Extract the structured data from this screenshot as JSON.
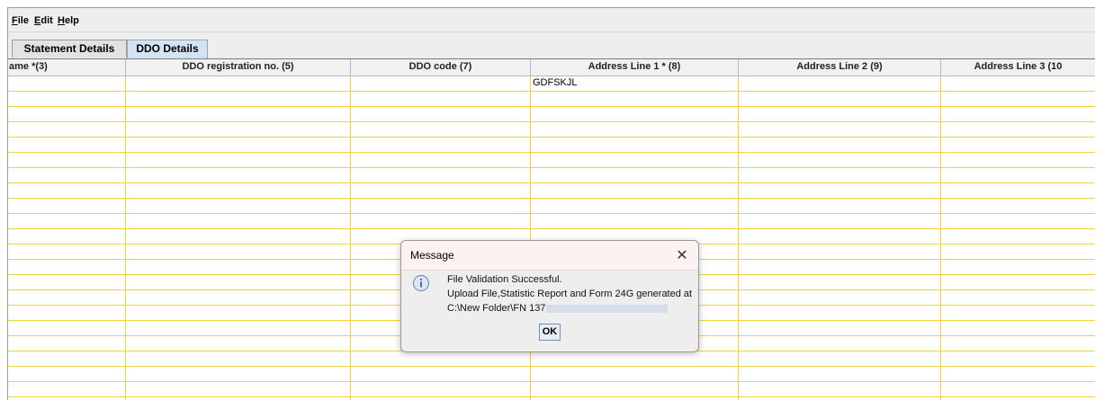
{
  "menu": {
    "items": [
      {
        "label_ul": "F",
        "label_rest": "ile"
      },
      {
        "label_ul": "E",
        "label_rest": "dit"
      },
      {
        "label_ul": "H",
        "label_rest": "elp"
      }
    ]
  },
  "tabs": [
    {
      "label": "Statement Details",
      "active": false
    },
    {
      "label": "DDO Details",
      "active": true
    }
  ],
  "table": {
    "columns": [
      "ame *(3)",
      "DDO registration no. (5)",
      "DDO code (7)",
      "Address Line 1 * (8)",
      "Address Line 2 (9)",
      "Address Line 3 (10"
    ],
    "first_row": [
      "",
      "",
      "",
      "GDFSKJL",
      "",
      ""
    ]
  },
  "dialog": {
    "title": "Message",
    "line1": "File Validation Successful.",
    "line2": "Upload File,Statistic Report and Form 24G generated at",
    "line3": "C:\\New Folder\\FN 137",
    "ok_label": "OK",
    "close_glyph": "✕"
  },
  "colors": {
    "grid_line": "#f2d33a",
    "active_tab": "#d4e3f2",
    "dialog_title_bg": "#fbf2f1"
  }
}
